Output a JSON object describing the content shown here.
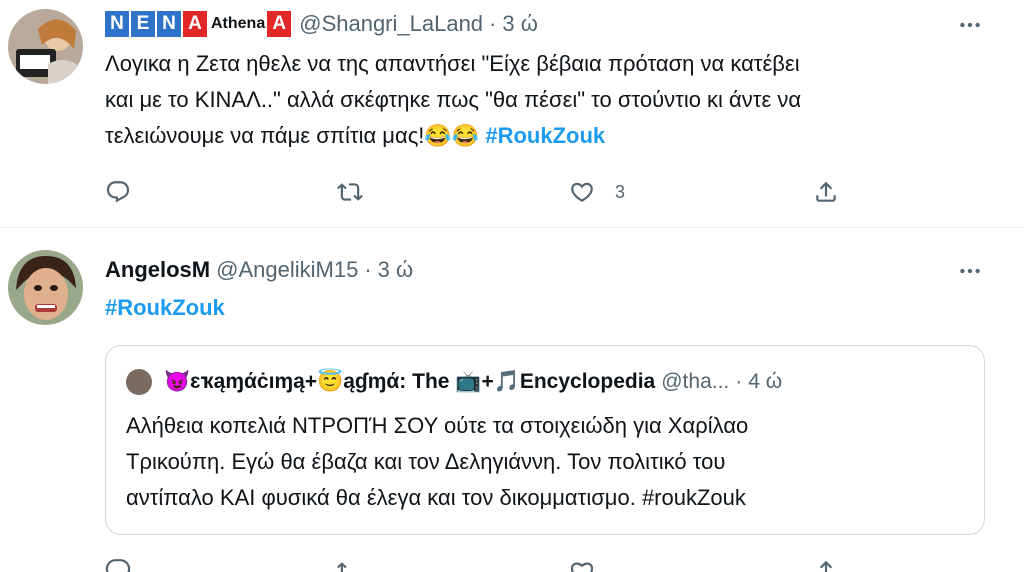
{
  "tweet1": {
    "name_parts": [
      "N",
      "E",
      "N",
      "A",
      "Athena",
      "A"
    ],
    "handle": "@Shangri_LaLand",
    "separator": "·",
    "time": "3 ώ",
    "text_line1": "Λογικα η Ζετα ηθελε να της απαντήσει \"Είχε βέβαια πρόταση να κατέβει",
    "text_line2": "και με το ΚΙΝΑΛ..\" αλλά σκέφτηκε πως \"θα πέσει\" το στούντιο κι άντε να",
    "text_line3": "τελειώνουμε να πάμε σπίτια μας!",
    "emojis": "😂😂",
    "hashtag": "#RoukZouk",
    "like_count": "3"
  },
  "tweet2": {
    "name": "AngelosM",
    "handle": "@AngelikiM15",
    "separator": "·",
    "time": "3 ώ",
    "hashtag": "#RoukZouk",
    "quote": {
      "name": "😈ɛҡąɱάċıɱą+😇ąɠɱά: The 📺+🎵Encyclopedia",
      "handle": "@tha...",
      "separator": "·",
      "time": "4 ώ",
      "line1": "Αλήθεια κοπελιά ΝΤΡΟΠΉ ΣΟΥ ούτε τα στοιχειώδη για Χαρίλαο",
      "line2": "Τρικούπη. Εγώ θα έβαζα και τον Δεληγιάννη. Τον πολιτικό του",
      "line3": "αντίπαλο ΚΑΙ φυσικά θα έλεγα και τον δικομματισμο. #roukZouk"
    }
  },
  "colors": {
    "accent": "#1d9bf0",
    "muted": "#536471",
    "badge_blue": "#2f73c8",
    "badge_red": "#e02828"
  },
  "icons": [
    "reply-icon",
    "retweet-icon",
    "like-icon",
    "share-icon",
    "more-icon"
  ]
}
